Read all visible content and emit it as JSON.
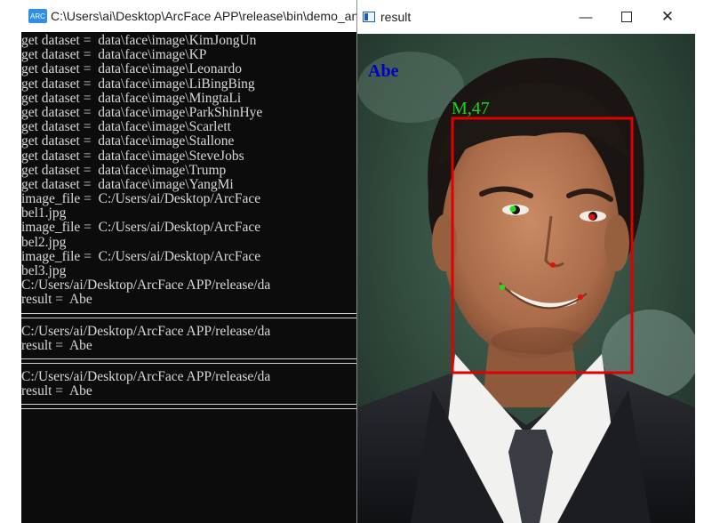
{
  "console": {
    "title": "C:\\Users\\ai\\Desktop\\ArcFace APP\\release\\bin\\demo_analy",
    "icon": "console-app-icon",
    "lines_a": [
      "get dataset =  data\\face\\image\\KimJongUn",
      "get dataset =  data\\face\\image\\KP",
      "get dataset =  data\\face\\image\\Leonardo",
      "get dataset =  data\\face\\image\\LiBingBing",
      "get dataset =  data\\face\\image\\MingtaLi",
      "get dataset =  data\\face\\image\\ParkShinHye",
      "get dataset =  data\\face\\image\\Scarlett",
      "get dataset =  data\\face\\image\\Stallone",
      "get dataset =  data\\face\\image\\SteveJobs",
      "get dataset =  data\\face\\image\\Trump",
      "get dataset =  data\\face\\image\\YangMi",
      "image_file =  C:/Users/ai/Desktop/ArcFace",
      "bel1.jpg",
      "image_file =  C:/Users/ai/Desktop/ArcFace",
      "bel2.jpg",
      "image_file =  C:/Users/ai/Desktop/ArcFace",
      "bel3.jpg",
      "C:/Users/ai/Desktop/ArcFace APP/release/da",
      "result =  Abe"
    ],
    "lines_b": [
      "C:/Users/ai/Desktop/ArcFace APP/release/da",
      "result =  Abe"
    ],
    "lines_c": [
      "C:/Users/ai/Desktop/ArcFace APP/release/da",
      "result =  Abe"
    ]
  },
  "result_window": {
    "title": "result",
    "minimize_glyph": "—",
    "close_glyph": "✕",
    "overlay_name": "Abe",
    "overlay_attr": "M,47",
    "colors": {
      "name_text": "#0000c8",
      "attr_text": "#1fd41f",
      "box": "#e00000",
      "landmark_green": "#22e022",
      "landmark_red": "#e01010"
    }
  }
}
